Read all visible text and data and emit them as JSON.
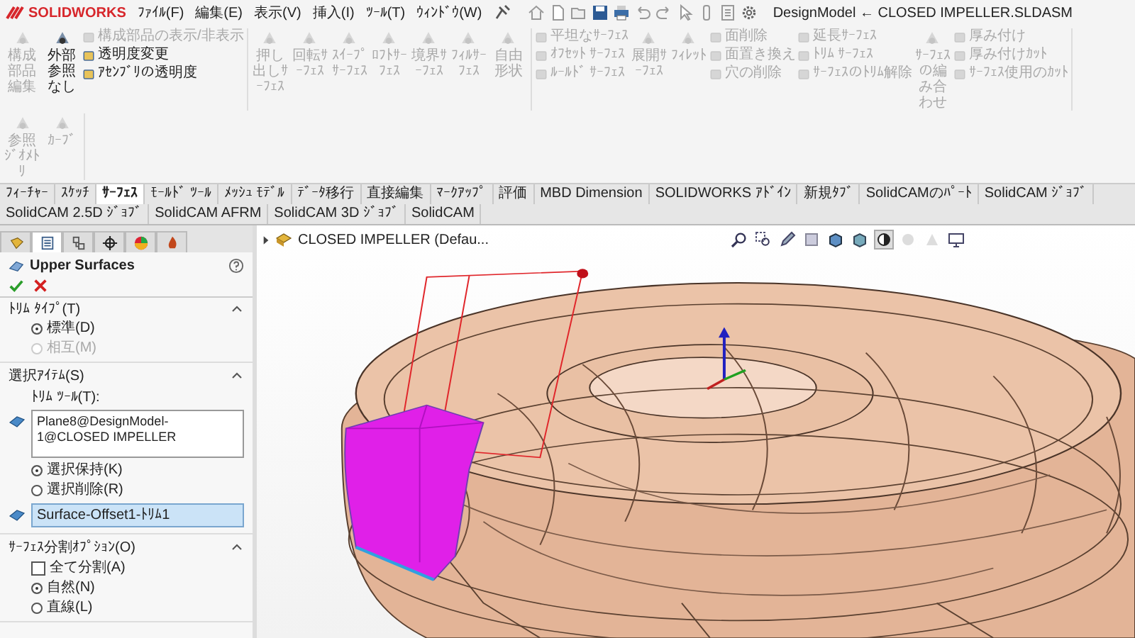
{
  "title_bar": {
    "logo": "SOLIDWORKS",
    "menus": [
      "ﾌｧｲﾙ(F)",
      "編集(E)",
      "表示(V)",
      "挿入(I)",
      "ﾂｰﾙ(T)",
      "ｳｨﾝﾄﾞｳ(W)"
    ],
    "title": "DesignModel ← CLOSED IMPELLER.SLDASM"
  },
  "ribbon": {
    "groups": [
      {
        "columns": [
          {
            "kind": "large",
            "items": [
              {
                "label": "構成部品編集",
                "disabled": true
              }
            ]
          },
          {
            "kind": "large",
            "items": [
              {
                "label": "外部参照なし",
                "disabled": false
              }
            ]
          },
          {
            "kind": "stack",
            "items": [
              {
                "label": "構成部品の表示/非表示",
                "disabled": true
              },
              {
                "label": "透明度変更",
                "disabled": false
              },
              {
                "label": "ｱｾﾝﾌﾞﾘの透明度",
                "disabled": false
              }
            ]
          }
        ]
      },
      {
        "columns": [
          {
            "kind": "large",
            "items": [
              {
                "label": "押し出しｻｰﾌｪｽ",
                "disabled": true
              }
            ]
          },
          {
            "kind": "large",
            "items": [
              {
                "label": "回転ｻｰﾌｪｽ",
                "disabled": true
              }
            ]
          },
          {
            "kind": "large",
            "items": [
              {
                "label": "ｽｲｰﾌﾟｻｰﾌｪｽ",
                "disabled": true
              }
            ]
          },
          {
            "kind": "large",
            "items": [
              {
                "label": "ﾛﾌﾄｻｰﾌｪｽ",
                "disabled": true
              }
            ]
          },
          {
            "kind": "large",
            "items": [
              {
                "label": "境界ｻｰﾌｪｽ",
                "disabled": true
              }
            ]
          },
          {
            "kind": "large",
            "items": [
              {
                "label": "ﾌｨﾙｻｰﾌｪｽ",
                "disabled": true
              }
            ]
          },
          {
            "kind": "large",
            "items": [
              {
                "label": "自由形状",
                "disabled": true
              }
            ]
          }
        ]
      },
      {
        "columns": [
          {
            "kind": "stack",
            "items": [
              {
                "label": "平坦なｻｰﾌｪｽ",
                "disabled": true
              },
              {
                "label": "ｵﾌｾｯﾄ ｻｰﾌｪｽ",
                "disabled": true
              },
              {
                "label": "ﾙｰﾙﾄﾞ ｻｰﾌｪｽ",
                "disabled": true
              }
            ]
          },
          {
            "kind": "large",
            "items": [
              {
                "label": "展開ｻｰﾌｪｽ",
                "disabled": true
              }
            ]
          },
          {
            "kind": "large",
            "items": [
              {
                "label": "ﾌｨﾚｯﾄ",
                "disabled": true
              }
            ]
          },
          {
            "kind": "stack",
            "items": [
              {
                "label": "面削除",
                "disabled": true
              },
              {
                "label": "面置き換え",
                "disabled": true
              },
              {
                "label": "穴の削除",
                "disabled": true
              }
            ]
          },
          {
            "kind": "stack",
            "items": [
              {
                "label": "延長ｻｰﾌｪｽ",
                "disabled": true
              },
              {
                "label": "ﾄﾘﾑ ｻｰﾌｪｽ",
                "disabled": true
              },
              {
                "label": "ｻｰﾌｪｽのﾄﾘﾑ解除",
                "disabled": true
              }
            ]
          },
          {
            "kind": "large",
            "items": [
              {
                "label": "ｻｰﾌｪｽの編み合わせ",
                "disabled": true
              }
            ]
          },
          {
            "kind": "stack",
            "items": [
              {
                "label": "厚み付け",
                "disabled": true
              },
              {
                "label": "厚み付けｶｯﾄ",
                "disabled": true
              },
              {
                "label": "ｻｰﾌｪｽ使用のｶｯﾄ",
                "disabled": true
              }
            ]
          }
        ]
      },
      {
        "columns": [
          {
            "kind": "large",
            "items": [
              {
                "label": "参照ｼﾞｵﾒﾄﾘ",
                "disabled": true
              }
            ]
          },
          {
            "kind": "large",
            "items": [
              {
                "label": "ｶｰﾌﾞ",
                "disabled": true
              }
            ]
          }
        ]
      }
    ]
  },
  "tabs": [
    {
      "label": "ﾌｨｰﾁｬｰ",
      "selected": false
    },
    {
      "label": "ｽｹｯﾁ",
      "selected": false
    },
    {
      "label": "ｻｰﾌｪｽ",
      "selected": true
    },
    {
      "label": "ﾓｰﾙﾄﾞ ﾂｰﾙ",
      "selected": false
    },
    {
      "label": "ﾒｯｼｭ ﾓﾃﾞﾙ",
      "selected": false
    },
    {
      "label": "ﾃﾞｰﾀ移行",
      "selected": false
    },
    {
      "label": "直接編集",
      "selected": false
    },
    {
      "label": "ﾏｰｸｱｯﾌﾟ",
      "selected": false
    },
    {
      "label": "評価",
      "selected": false
    },
    {
      "label": "MBD Dimension",
      "selected": false
    },
    {
      "label": "SOLIDWORKS ｱﾄﾞｲﾝ",
      "selected": false
    },
    {
      "label": "新規ﾀﾌﾞ",
      "selected": false
    },
    {
      "label": "SolidCAMのﾊﾟｰﾄ",
      "selected": false
    },
    {
      "label": "SolidCAM ｼﾞｮﾌﾞ",
      "selected": false
    },
    {
      "label": "SolidCAM 2.5D ｼﾞｮﾌﾞ",
      "selected": false
    },
    {
      "label": "SolidCAM AFRM",
      "selected": false
    },
    {
      "label": "SolidCAM 3D ｼﾞｮﾌﾞ",
      "selected": false
    },
    {
      "label": "SolidCAM",
      "selected": false
    }
  ],
  "panel": {
    "tabs": [
      {
        "kind": "tree",
        "selected": false
      },
      {
        "kind": "property",
        "selected": true
      },
      {
        "kind": "config",
        "selected": false
      },
      {
        "kind": "target",
        "selected": false
      },
      {
        "kind": "appearance",
        "selected": false
      },
      {
        "kind": "cam",
        "selected": false
      }
    ],
    "title": "Upper Surfaces",
    "sections": [
      {
        "heading": "ﾄﾘﾑ ﾀｲﾌﾟ(T)",
        "expanded": true,
        "rows": [
          {
            "kind": "radio",
            "label": "標準(D)",
            "selected": true,
            "disabled": false
          },
          {
            "kind": "radio",
            "label": "相互(M)",
            "selected": false,
            "disabled": true
          }
        ]
      },
      {
        "heading": "選択ｱｲﾃﾑ(S)",
        "expanded": true,
        "rows": [
          {
            "kind": "caption",
            "label": "ﾄﾘﾑ ﾂｰﾙ(T):"
          },
          {
            "kind": "list",
            "value": "Plane8@DesignModel-1@CLOSED IMPELLER",
            "selected": false
          },
          {
            "kind": "radio",
            "label": "選択保持(K)",
            "selected": true,
            "disabled": false
          },
          {
            "kind": "radio",
            "label": "選択削除(R)",
            "selected": false,
            "disabled": false
          },
          {
            "kind": "list",
            "value": "Surface-Offset1-ﾄﾘﾑ1",
            "selected": true
          }
        ]
      },
      {
        "heading": "ｻｰﾌｪｽ分割ｵﾌﾟｼｮﾝ(O)",
        "expanded": true,
        "rows": [
          {
            "kind": "check",
            "label": "全て分割(A)",
            "checked": false
          },
          {
            "kind": "radio",
            "label": "自然(N)",
            "selected": true,
            "disabled": false
          },
          {
            "kind": "radio",
            "label": "直線(L)",
            "selected": false,
            "disabled": false
          }
        ]
      }
    ]
  },
  "viewport": {
    "breadcrumb": "CLOSED IMPELLER (Defau..."
  }
}
